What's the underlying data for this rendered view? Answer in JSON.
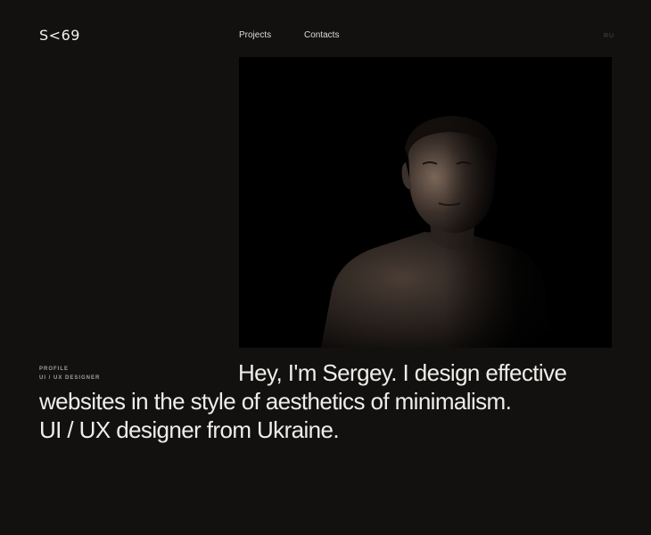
{
  "header": {
    "logo": "S<69",
    "nav": [
      {
        "label": "Projects"
      },
      {
        "label": "Contacts"
      }
    ],
    "language": "RU"
  },
  "profile": {
    "label": "PROFILE",
    "role": "UI / UX DESIGNER"
  },
  "hero": {
    "line1": "Hey, I'm Sergey. I design effective",
    "line2": "websites in the style of aesthetics of minimalism.",
    "line3": "UI / UX designer from Ukraine."
  },
  "colors": {
    "background": "#121110",
    "text": "#efede9",
    "muted": "#a29e98"
  }
}
